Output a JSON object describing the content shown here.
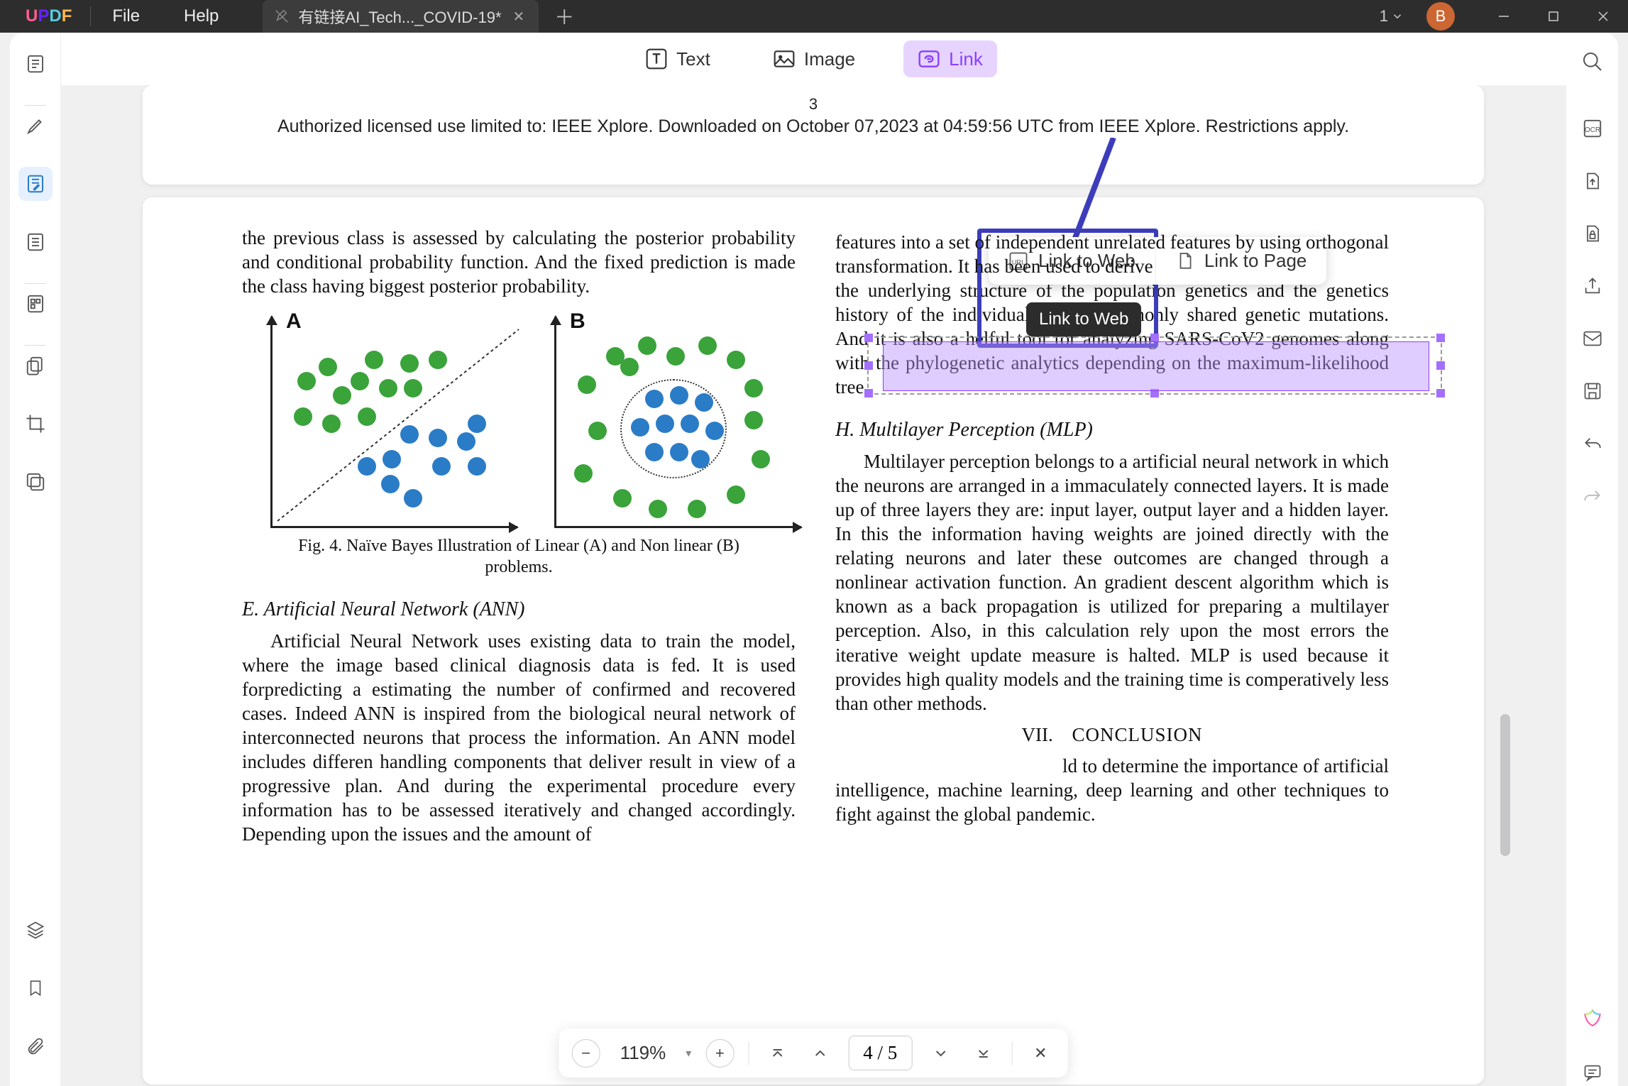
{
  "titlebar": {
    "menu_file": "File",
    "menu_help": "Help",
    "tab_title": "有链接AI_Tech..._COVID-19*",
    "tab_count": "1",
    "avatar_letter": "B"
  },
  "toolbar": {
    "text_label": "Text",
    "image_label": "Image",
    "link_label": "Link"
  },
  "page1": {
    "number": "3",
    "footer": "Authorized licensed use limited to: IEEE Xplore. Downloaded on October 07,2023 at 04:59:56 UTC from IEEE Xplore.  Restrictions apply."
  },
  "page2": {
    "left_p1": "the previous class is assessed by calculating the posterior probability and conditional probability function. And   the fixed prediction is made the class having biggest posterior probability.",
    "fig_caption_l1": "Fig. 4.   Naïve Bayes Illustration of Linear (A) and Non linear (B)",
    "fig_caption_l2": "problems.",
    "sec_e": "E.    Artificial Neural Network (ANN)",
    "left_p2": "Artificial Neural Network uses existing data to train the model, where the image based clinical diagnosis data is fed. It is used forpredicting a estimating the number of confirmed and recovered cases. Indeed ANN is inspired from the biological neural network of interconnected neurons that process the information. An ANN model includes differen handling components that deliver result in view of a progressive plan. And during the experimental procedure every  information has to be assessed iteratively and changed accordingly. Depending upon the issues and the amount of",
    "right_high": "features into a set of independent unrelated features by using orthogonal transformation. It has been used to derive",
    "right_p1": "the underlying structure of the population genetics and the genetics history of the individual with a commonly shared genetic mutations. And it is also a helful tool for analyzing SARS-CoV2 genomes along with the phylogenetic analytics depending on the maximum-likelihood tree",
    "sec_h": "H.   Multilayer Perception (MLP)",
    "right_p2": "Multilayer perception belongs to a artificial neural network in which the neurons are arranged in a immaculately connected layers. It is made up of three layers they are: input layer, output layer and a hidden layer. In this the information having weights are joined directly with the relating neurons and later these outcomes are changed through a nonlinear activation function. An gradient descent algorithm which is known as a back propagation is utilized for preparing a multilayer perception. Also, in this calculation rely upon the most errors the iterative weight update measure is halted. MLP is used because it provides high quality models and the training time is comperatively less than other methods.",
    "conc_num": "VII.",
    "conc_title": "CONCLUSION",
    "right_p3": "ld to determine the importance of artificial intelligence, machine learning, deep learning and other techniques to fight against the global pandemic."
  },
  "link_popup": {
    "web": "Link to Web",
    "page": "Link to Page",
    "tooltip": "Link to Web"
  },
  "bottom": {
    "zoom": "119%",
    "page": "4  /  5"
  }
}
